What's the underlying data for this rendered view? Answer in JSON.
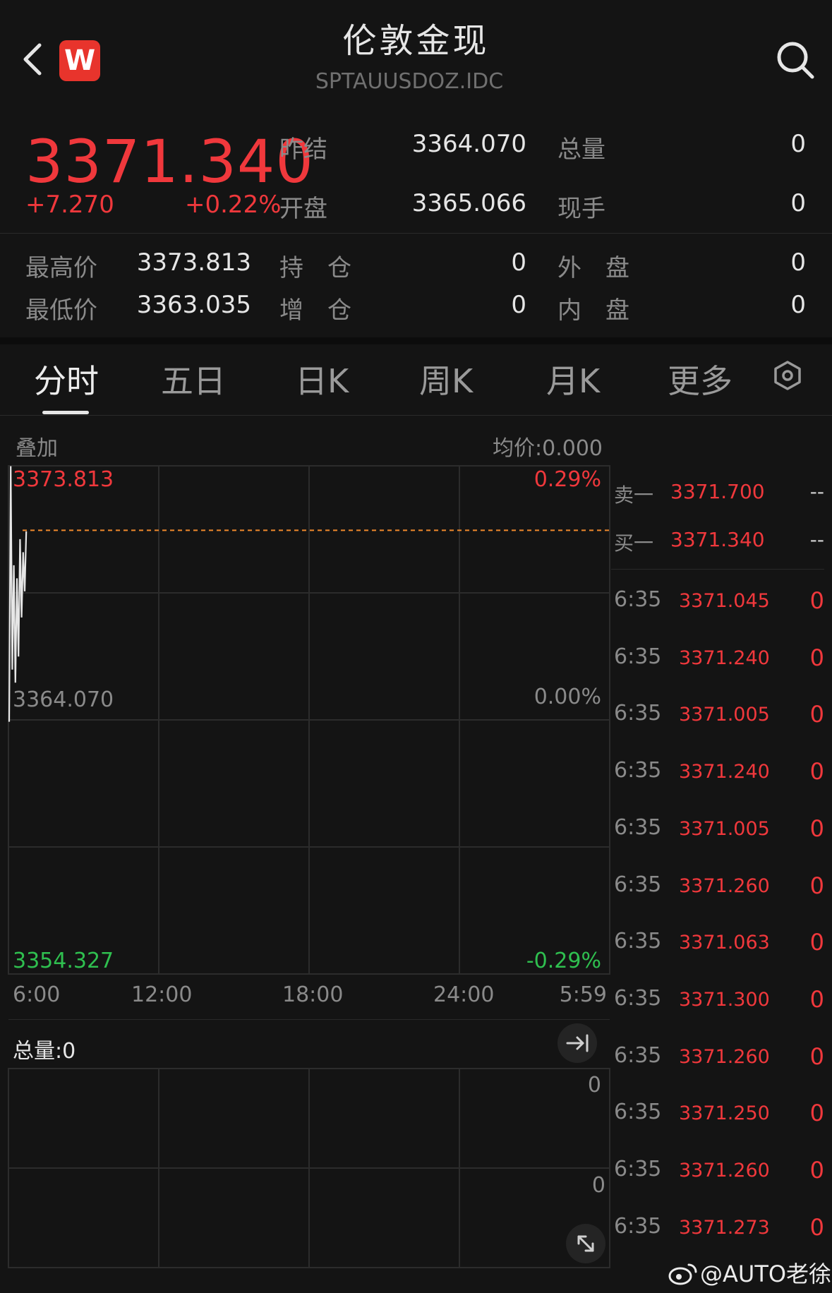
{
  "header": {
    "title": "伦敦金现",
    "subtitle": "SPTAUUSDOZ.IDC",
    "app_logo_text": "W"
  },
  "quote": {
    "price": "3371.340",
    "change": "+7.270",
    "change_pct": "+0.22%",
    "prev_settle_label": "昨结",
    "prev_settle": "3364.070",
    "total_vol_label": "总量",
    "total_vol": "0",
    "open_label": "开盘",
    "open": "3365.066",
    "current_hand_label": "现手",
    "current_hand": "0",
    "high_label": "最高价",
    "high": "3373.813",
    "low_label": "最低价",
    "low": "3363.035",
    "open_interest_label": "持　仓",
    "open_interest": "0",
    "oi_change_label": "增　仓",
    "oi_change": "0",
    "outer_label": "外　盘",
    "outer": "0",
    "inner_label": "内　盘",
    "inner": "0"
  },
  "tabs": [
    "分时",
    "五日",
    "日K",
    "周K",
    "月K",
    "更多"
  ],
  "chart": {
    "overlay_label": "叠加",
    "avg_price_label": "均价:0.000",
    "top_price": "3373.813",
    "mid_price": "3364.070",
    "bottom_price": "3354.327",
    "top_pct": "0.29%",
    "mid_pct": "0.00%",
    "bottom_pct": "-0.29%",
    "time_labels": [
      "6:00",
      "12:00",
      "18:00",
      "24:00",
      "5:59"
    ],
    "volume_label": "总量:0",
    "volume_axis_top": "0",
    "volume_axis_mid": "0"
  },
  "chart_data": {
    "type": "line",
    "ylim": [
      3354.327,
      3373.813
    ],
    "reference_price": 3364.07,
    "current_price": 3371.34,
    "series": [
      {
        "values": [
          3364.0,
          3373.8,
          3366.0,
          3370.0,
          3365.5,
          3369.5,
          3366.5,
          3371.0,
          3368.0,
          3370.5,
          3369.0,
          3371.3
        ]
      }
    ]
  },
  "order_book": {
    "sell1_label": "卖一",
    "sell1_price": "3371.700",
    "sell1_vol": "--",
    "buy1_label": "买一",
    "buy1_price": "3371.340",
    "buy1_vol": "--"
  },
  "ticks": [
    {
      "time": "6:35",
      "price": "3371.045",
      "vol": "0"
    },
    {
      "time": "6:35",
      "price": "3371.240",
      "vol": "0"
    },
    {
      "time": "6:35",
      "price": "3371.005",
      "vol": "0"
    },
    {
      "time": "6:35",
      "price": "3371.240",
      "vol": "0"
    },
    {
      "time": "6:35",
      "price": "3371.005",
      "vol": "0"
    },
    {
      "time": "6:35",
      "price": "3371.260",
      "vol": "0"
    },
    {
      "time": "6:35",
      "price": "3371.063",
      "vol": "0"
    },
    {
      "time": "6:35",
      "price": "3371.300",
      "vol": "0"
    },
    {
      "time": "6:35",
      "price": "3371.260",
      "vol": "0"
    },
    {
      "time": "6:35",
      "price": "3371.250",
      "vol": "0"
    },
    {
      "time": "6:35",
      "price": "3371.260",
      "vol": "0"
    },
    {
      "time": "6:35",
      "price": "3371.273",
      "vol": "0"
    }
  ],
  "watermark": "@AUTO老徐",
  "colors": {
    "up": "#f0383c",
    "down": "#2fbf4f",
    "reference_line": "#f08a2c",
    "background": "#141414"
  }
}
